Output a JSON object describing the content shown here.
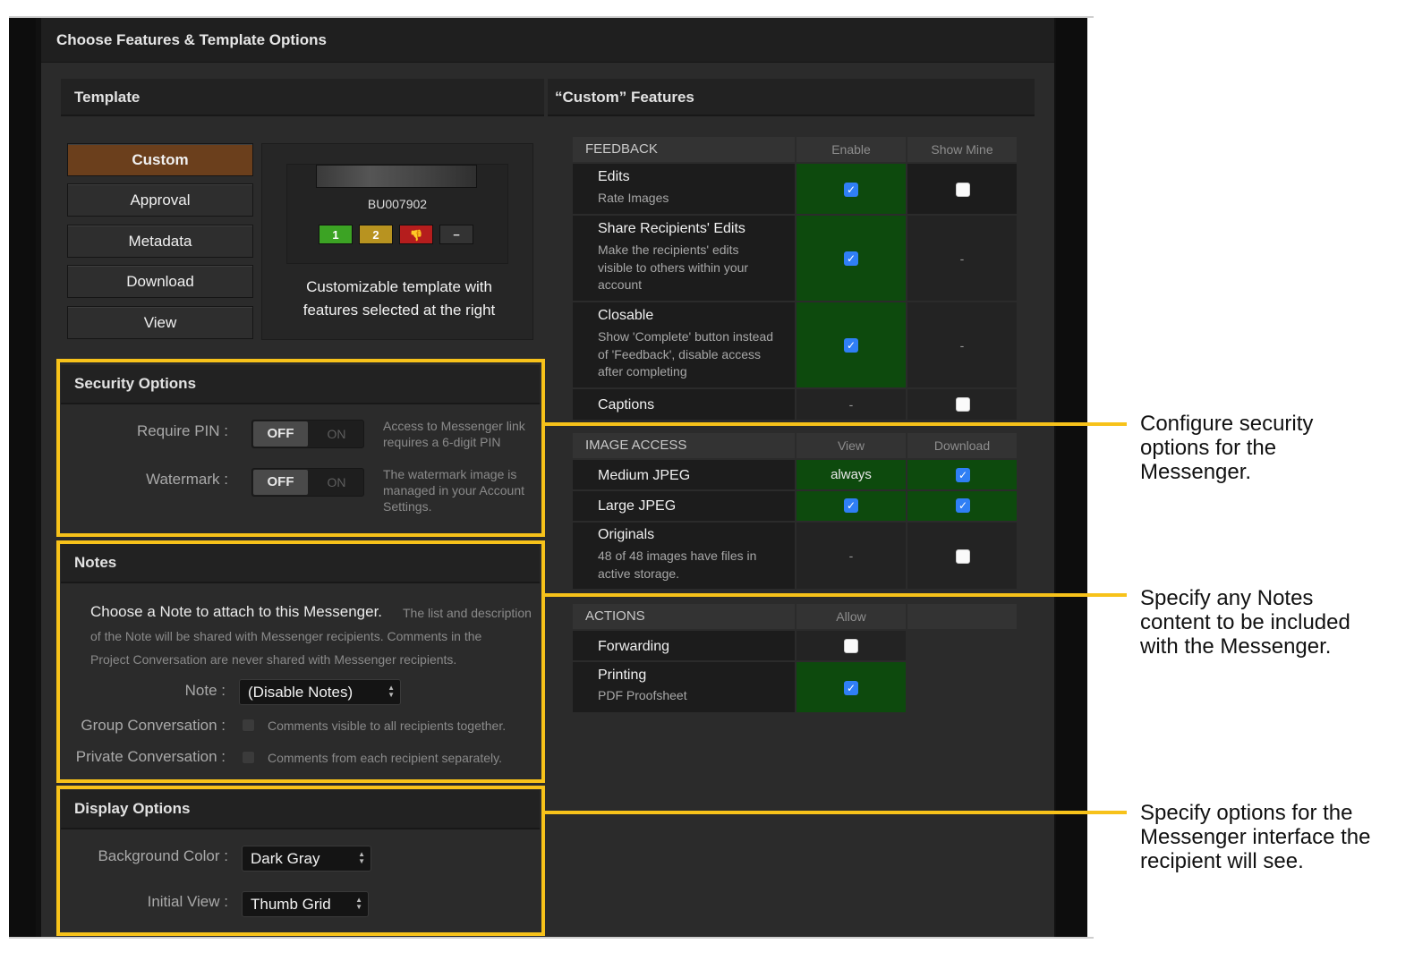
{
  "window": {
    "title": "Choose Features & Template Options"
  },
  "template": {
    "heading": "Template",
    "buttons": [
      "Custom",
      "Approval",
      "Metadata",
      "Download",
      "View"
    ],
    "preview": {
      "code": "BU007902",
      "ratings": [
        "1",
        "2",
        "👎",
        "−"
      ],
      "description_line1": "Customizable template with",
      "description_line2": "features selected at the right"
    }
  },
  "security": {
    "heading": "Security Options",
    "require_pin": {
      "label": "Require PIN :",
      "off": "OFF",
      "on": "ON",
      "desc_line1": "Access to Messenger link",
      "desc_line2": "requires a 6-digit PIN"
    },
    "watermark": {
      "label": "Watermark :",
      "off": "OFF",
      "on": "ON",
      "desc_line1": "The watermark image is",
      "desc_line2": "managed in your Account",
      "desc_line3": "Settings."
    }
  },
  "notes": {
    "heading": "Notes",
    "intro_main": "Choose a Note to attach to this Messenger.",
    "intro_rest1": "The list and description",
    "intro_rest2": "of the Note will be shared with Messenger recipients. Comments in the",
    "intro_rest3": "Project Conversation are never shared with Messenger recipients.",
    "note_label": "Note :",
    "note_value": "(Disable Notes)",
    "group_label": "Group Conversation :",
    "group_desc": "Comments visible to all recipients together.",
    "private_label": "Private Conversation :",
    "private_desc": "Comments from each recipient separately."
  },
  "display": {
    "heading": "Display Options",
    "bg_label": "Background Color :",
    "bg_value": "Dark Gray",
    "view_label": "Initial View :",
    "view_value": "Thumb Grid"
  },
  "features": {
    "heading": "“Custom” Features",
    "feedback": {
      "title": "FEEDBACK",
      "col1": "Enable",
      "col2": "Show Mine",
      "rows": [
        {
          "name": "Edits",
          "sub": "Rate Images",
          "enable": "checked",
          "show": "unchecked"
        },
        {
          "name": "Share Recipients' Edits",
          "sub1": "Make the recipients' edits",
          "sub2": "visible to others within your",
          "sub3": "account",
          "enable": "checked",
          "show": "-"
        },
        {
          "name": "Closable",
          "sub1": "Show 'Complete' button instead",
          "sub2": "of 'Feedback', disable access",
          "sub3": "after completing",
          "enable": "checked",
          "show": "-"
        },
        {
          "name": "Captions",
          "enable": "-",
          "show": "unchecked"
        }
      ]
    },
    "image_access": {
      "title": "IMAGE ACCESS",
      "col1": "View",
      "col2": "Download",
      "rows": [
        {
          "name": "Medium JPEG",
          "view": "always",
          "download": "checked"
        },
        {
          "name": "Large JPEG",
          "view": "checked",
          "download": "checked"
        },
        {
          "name": "Originals",
          "sub1": "48 of 48 images have files in",
          "sub2": "active storage.",
          "view": "-",
          "download": "unchecked"
        }
      ]
    },
    "actions": {
      "title": "ACTIONS",
      "col1": "Allow",
      "rows": [
        {
          "name": "Forwarding",
          "allow": "unchecked"
        },
        {
          "name": "Printing",
          "sub": "PDF Proofsheet",
          "allow": "checked"
        }
      ]
    }
  },
  "callouts": {
    "security_1": "Configure security",
    "security_2": "options for the",
    "security_3": "Messenger.",
    "notes_1": "Specify any Notes",
    "notes_2": "content to be included",
    "notes_3": "with the Messenger.",
    "display_1": "Specify options for the",
    "display_2": "Messenger interface the",
    "display_3": "recipient will see."
  },
  "colors": {
    "highlight": "#f7c21a",
    "active_template": "#6b3f1c",
    "enabled_cell": "#0d4a0d",
    "checkbox": "#2f7ff5"
  },
  "icons": {
    "thumbs_down": "thumbs-down-icon",
    "select_arrows": "updown-arrows-icon",
    "checkmark": "checkmark-icon"
  }
}
